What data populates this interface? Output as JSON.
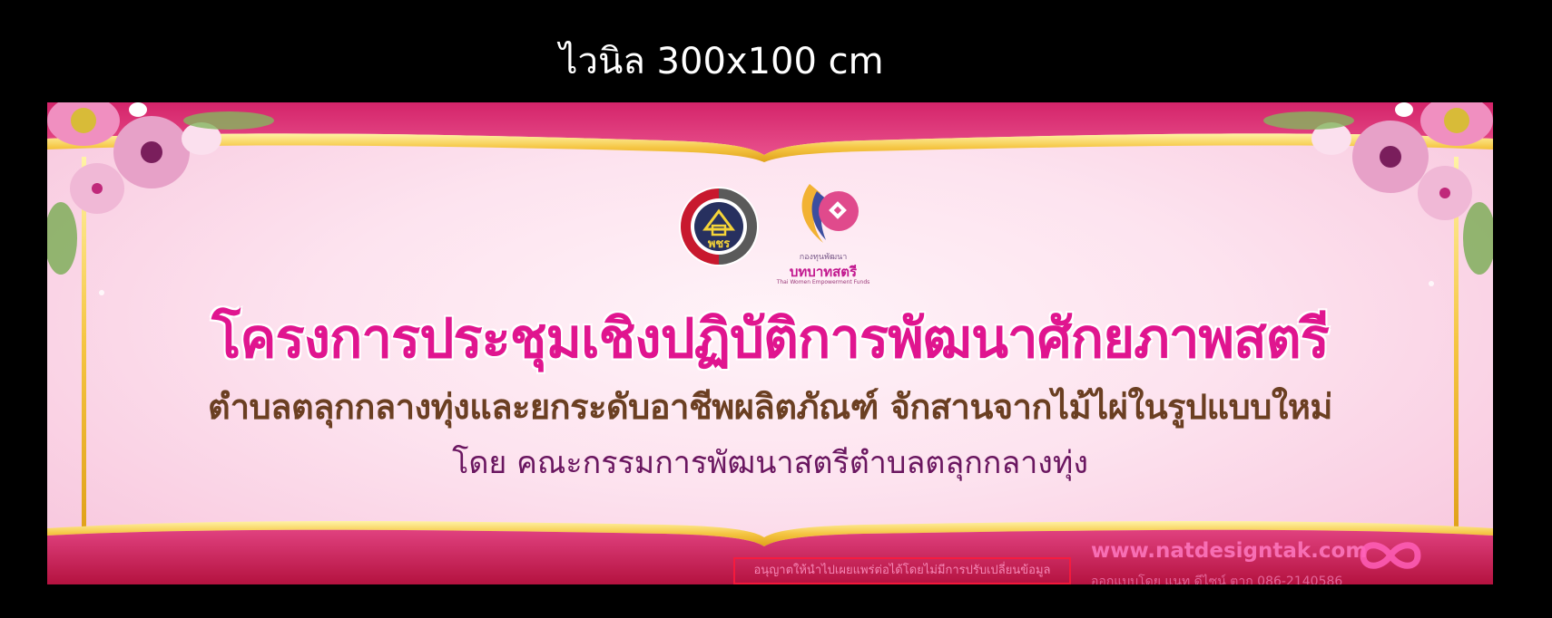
{
  "caption": "ไวนิล 300x100 cm",
  "banner": {
    "title": "โครงการประชุมเชิงปฏิบัติการพัฒนาศักยภาพสตรี",
    "subtitle": "ตำบลตลุกกลางทุ่งและยกระดับอาชีพผลิตภัณฑ์  จักสานจากไม้ไผ่ในรูปแบบใหม่",
    "byline": "โดย  คณะกรรมการพัฒนาสตรีตำบลตลุกกลางทุ่ง",
    "logo_right": {
      "line1": "กองทุนพัฒนา",
      "line2": "บทบาทสตรี",
      "line3": "Thai Women Empowerment Funds"
    },
    "logo_left_text": "พชร",
    "watermark": {
      "website": "www.natdesigntak.com",
      "contact": "ออกแบบโดย แนท ดีไซน์ ตาก 086-2140586",
      "notice": "อนุญาตให้นำไปเผยแพร่ต่อได้โดยไม่มีการปรับเปลี่ยนข้อมูล"
    }
  },
  "colors": {
    "magenta": "#e0158f",
    "brown": "#6b3f22",
    "purple": "#6a1660",
    "gold": "#f5c542",
    "crimson": "#c8174f"
  }
}
